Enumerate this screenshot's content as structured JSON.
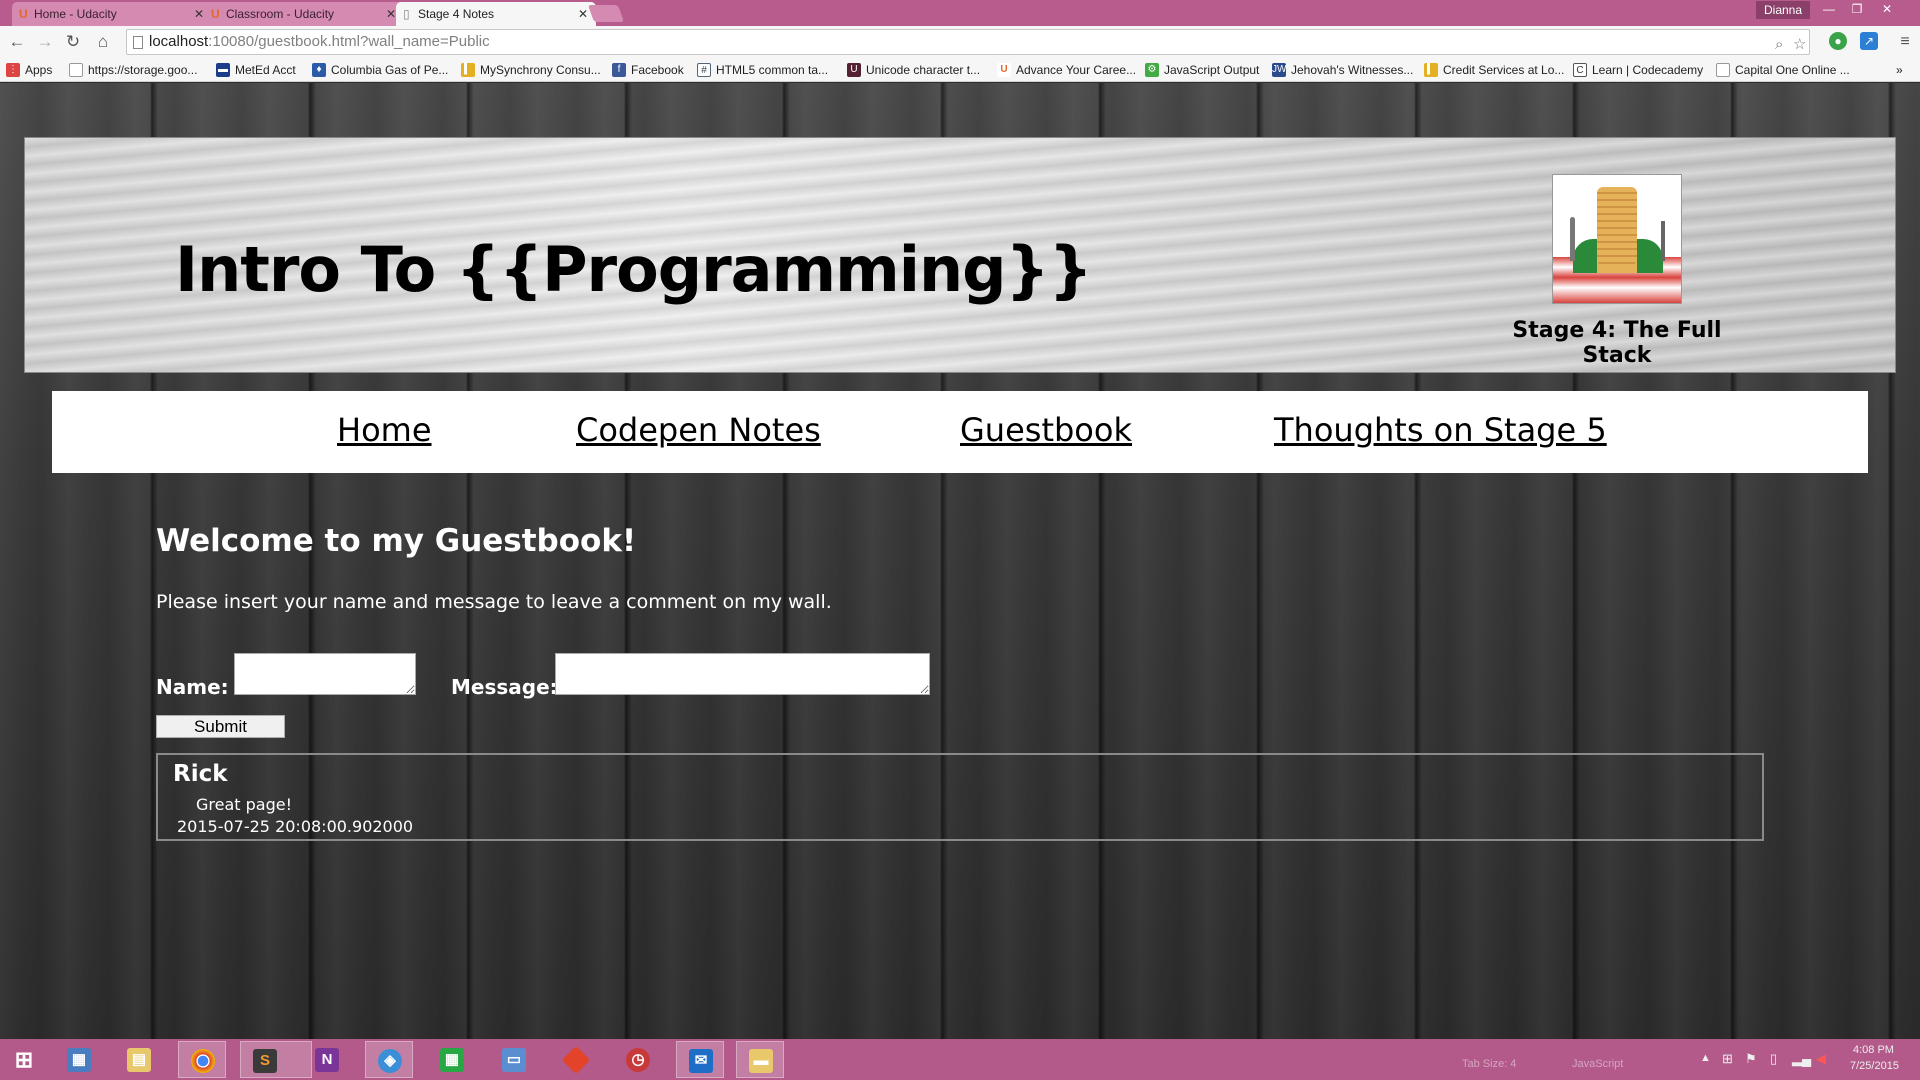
{
  "browser": {
    "tabs": [
      {
        "title": "Home - Udacity",
        "icon": "udacity-icon"
      },
      {
        "title": "Classroom - Udacity",
        "icon": "udacity-icon"
      },
      {
        "title": "Stage 4 Notes",
        "icon": "page-icon"
      }
    ],
    "profile_name": "Dianna",
    "url_host": "localhost",
    "url_rest": ":10080/guestbook.html?wall_name=Public",
    "bookmarks": [
      "Apps",
      "https://storage.goo...",
      "MetEd Acct",
      "Columbia Gas of Pe...",
      "MySynchrony Consu...",
      "Facebook",
      "HTML5 common ta...",
      "Unicode character t...",
      "Advance Your Caree...",
      "JavaScript Output",
      "Jehovah's Witnesses...",
      "Credit Services at Lo...",
      "Learn | Codecademy",
      "Capital One Online ..."
    ],
    "bookmarks_overflow": "»"
  },
  "page": {
    "site_title": "Intro To {{Programming}}",
    "stage_label": "Stage 4: The Full Stack",
    "nav": [
      "Home",
      "Codepen Notes",
      "Guestbook",
      "Thoughts on Stage 5"
    ],
    "welcome": "Welcome to my Guestbook!",
    "instructions": "Please insert your name and message to leave a comment on my wall.",
    "form": {
      "name_label": "Name:",
      "name_value": "",
      "message_label": "Message:",
      "message_value": "",
      "submit_label": "Submit"
    },
    "comments": [
      {
        "author": "Rick",
        "message": "Great page!",
        "date": "2015-07-25 20:08:00.902000"
      }
    ]
  },
  "taskbar": {
    "apps": [
      "start",
      "explorer",
      "file-manager",
      "chrome",
      "sublime-text",
      "onenote",
      "network",
      "calculator",
      "remote-desktop",
      "git",
      "alarms",
      "mail",
      "folder"
    ],
    "faint_labels": [
      "Tab Size: 4",
      "JavaScript"
    ],
    "clock_time": "4:08 PM",
    "clock_date": "7/25/2015"
  },
  "colors": {
    "tab_strip": "#b85b8d",
    "taskbar": "#b35a8b",
    "page_text": "#ffffff",
    "nav_bg": "#ffffff"
  }
}
